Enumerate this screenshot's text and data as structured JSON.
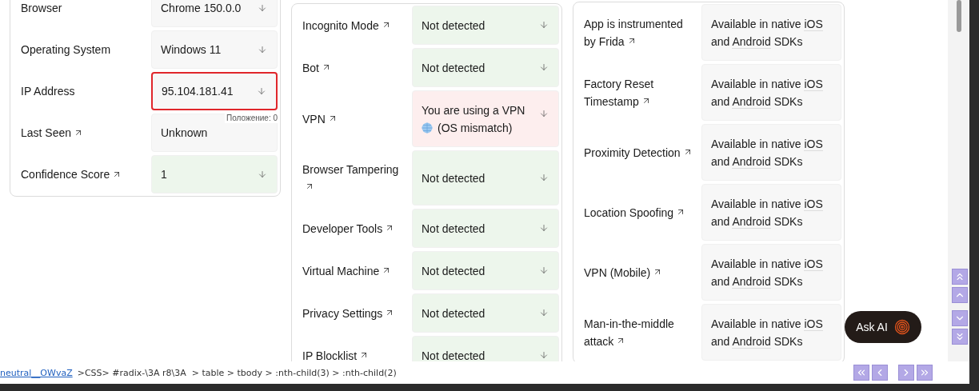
{
  "identification": {
    "rows": [
      {
        "label": "Browser",
        "link": false,
        "value": "Chrome 150.0.0",
        "kind": "neutral",
        "expandable": true,
        "highlighted": false
      },
      {
        "label": "Operating System",
        "link": false,
        "value": "Windows 11",
        "kind": "neutral",
        "expandable": true,
        "highlighted": false
      },
      {
        "label": "IP Address",
        "link": false,
        "value": "95.104.181.41",
        "kind": "neutral",
        "expandable": true,
        "highlighted": true,
        "tooltip": "Положение: 0"
      },
      {
        "label": "Last Seen",
        "link": true,
        "value": "Unknown",
        "kind": "neutral",
        "expandable": false,
        "highlighted": false
      },
      {
        "label": "Confidence Score",
        "link": true,
        "value": "1",
        "kind": "success",
        "expandable": true,
        "highlighted": false
      }
    ]
  },
  "smart_signals": {
    "rows": [
      {
        "label": "Incognito Mode",
        "value": "Not detected",
        "kind": "success"
      },
      {
        "label": "Bot",
        "value": "Not detected",
        "kind": "success"
      },
      {
        "label": "VPN",
        "value": "You are using a VPN",
        "note": "(OS mismatch)",
        "kind": "danger"
      },
      {
        "label": "Browser Tampering",
        "value": "Not detected",
        "kind": "success"
      },
      {
        "label": "Developer Tools",
        "value": "Not detected",
        "kind": "success"
      },
      {
        "label": "Virtual Machine",
        "value": "Not detected",
        "kind": "success"
      },
      {
        "label": "Privacy Settings",
        "value": "Not detected",
        "kind": "success"
      },
      {
        "label": "IP Blocklist",
        "value": "Not detected",
        "kind": "success"
      }
    ]
  },
  "mobile_signals": {
    "rows": [
      {
        "label": "App is instrumented by Frida",
        "value": [
          "Available in native ",
          "iOS",
          " and ",
          "Android",
          " SDKs"
        ]
      },
      {
        "label": "Factory Reset Timestamp",
        "value": [
          "Available in native ",
          "iOS",
          " and ",
          "Android",
          " SDKs"
        ]
      },
      {
        "label": "Proximity Detection",
        "value": [
          "Available in native ",
          "iOS",
          " and ",
          "Android",
          " SDKs"
        ]
      },
      {
        "label": "Location Spoofing",
        "value": [
          "Available in native ",
          "iOS",
          " and ",
          "Android",
          " SDKs"
        ]
      },
      {
        "label": "VPN (Mobile)",
        "value": [
          "Available in native ",
          "iOS",
          " and ",
          "Android",
          " SDKs"
        ]
      },
      {
        "label": "Man-in-the-middle attack",
        "value": [
          "Available in native ",
          "iOS",
          " and ",
          "Android",
          " SDKs"
        ]
      }
    ]
  },
  "ask_ai": {
    "label": "Ask AI"
  },
  "status_bar": {
    "link": "neutral__OWvaZ",
    "path": ">CSS> #radix-\\3A r8\\3A  > table > tbody > :nth-child(3) > :nth-child(2)"
  }
}
